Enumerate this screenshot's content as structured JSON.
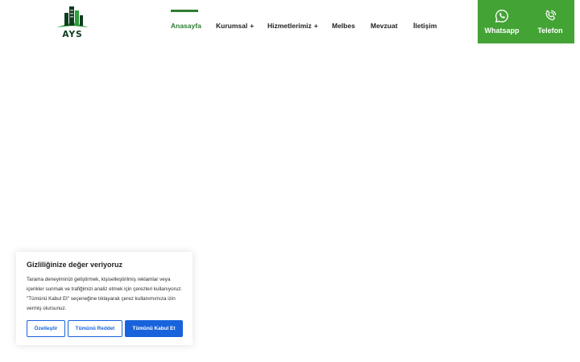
{
  "header": {
    "logo_text": "AYS",
    "nav": [
      {
        "label": "Anasayfa",
        "active": true,
        "has_submenu": false
      },
      {
        "label": "Kurumsal",
        "active": false,
        "has_submenu": true
      },
      {
        "label": "Hizmetlerimiz",
        "active": false,
        "has_submenu": true
      },
      {
        "label": "Melbes",
        "active": false,
        "has_submenu": false
      },
      {
        "label": "Mevzuat",
        "active": false,
        "has_submenu": false
      },
      {
        "label": "İletişim",
        "active": false,
        "has_submenu": false
      }
    ],
    "submenu_symbol": "+",
    "contact": {
      "whatsapp_label": "Whatsapp",
      "phone_label": "Telefon"
    }
  },
  "cookie_banner": {
    "title": "Gizliliğinize değer veriyoruz",
    "text": "Tarama deneyiminizi geliştirmek, kişiselleştirilmiş reklamlar veya içerikler sunmak ve trafiğimizi analiz etmek için çerezleri kullanıyoruz. \"Tümünü Kabul Et\" seçeneğine tıklayarak çerez kullanımımıza izin vermiş olursunuz.",
    "customize_label": "Özelleştir",
    "reject_label": "Tümünü Reddet",
    "accept_label": "Tümünü Kabul Et"
  },
  "colors": {
    "brand_green": "#43a335",
    "nav_active": "#2e7d32",
    "cookie_blue": "#1863dc"
  }
}
